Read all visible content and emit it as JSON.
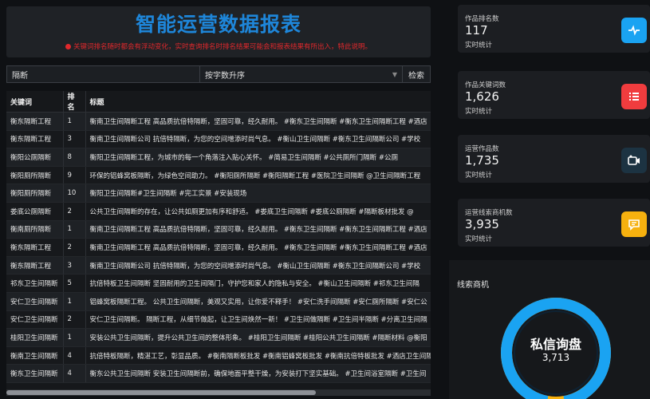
{
  "header": {
    "title": "智能运营数据报表",
    "notice": "关键词排名随时都会有浮动变化，实时查询排名时排名结果可能会和报表结果有所出入，特此说明。"
  },
  "search": {
    "keyword_value": "隔断",
    "sort_value": "按字数升序",
    "button_label": "检索"
  },
  "table": {
    "columns": [
      "关键词",
      "排名",
      "标题"
    ],
    "rows": [
      {
        "keyword": "衡东隔断工程",
        "rank": "1",
        "title": "衡南卫生间隔断工程 高品质抗倍特隔断，坚固可靠，经久耐用。 #衡东卫生间隔断 #衡东卫生间隔断工程 #酒店"
      },
      {
        "keyword": "衡东隔断工程",
        "rank": "3",
        "title": "衡南卫生间隔断公司 抗倍特隔断，为您的空间增添时尚气息。 #衡山卫生间隔断 #衡东卫生间隔断公司 #学校"
      },
      {
        "keyword": "衡阳公厕隔断",
        "rank": "8",
        "title": "衡阳卫生间隔断工程，为城市的每一个角落注入贴心关怀。 #简易卫生间隔断 #公共厕所门隔断 #公厕"
      },
      {
        "keyword": "衡阳厕所隔断",
        "rank": "9",
        "title": "环保的铝蜂窝板隔断，为绿色空间助力。 #衡阳厕所隔断 #衡阳隔断工程 #医院卫生间隔断 @卫生间隔断工程"
      },
      {
        "keyword": "衡阳厕所隔断",
        "rank": "10",
        "title": "衡阳卫生间隔断#卫生间隔断 #完工实景 #安装现场"
      },
      {
        "keyword": "娄底公厕隔断",
        "rank": "2",
        "title": "公共卫生间隔断的存在，让公共如厕更加有序和舒适。 #娄底卫生间隔断 #娄底公厕隔断 #隔断板材批发 @"
      },
      {
        "keyword": "衡南厕所隔断",
        "rank": "1",
        "title": "衡南卫生间隔断工程 高品质抗倍特隔断，坚固可靠，经久耐用。 #衡东卫生间隔断 #衡东卫生间隔断工程 #酒店"
      },
      {
        "keyword": "衡东隔断工程",
        "rank": "2",
        "title": "衡南卫生间隔断工程 高品质抗倍特隔断，坚固可靠，经久耐用。 #衡东卫生间隔断 #衡东卫生间隔断工程 #酒店"
      },
      {
        "keyword": "衡东隔断工程",
        "rank": "3",
        "title": "衡南卫生间隔断公司 抗倍特隔断，为您的空间增添时尚气息。 #衡山卫生间隔断 #衡东卫生间隔断公司 #学校"
      },
      {
        "keyword": "祁东卫生间隔断",
        "rank": "5",
        "title": "抗倍特板卫生间隔断 坚固耐用的卫生间隔门，守护您和家人的隐私与安全。 #衡山卫生间隔断 #祁东卫生间隔"
      },
      {
        "keyword": "安仁卫生间隔断",
        "rank": "1",
        "title": "铝蜂窝板隔断工程。 公共卫生间隔断，美观又实用，让你爱不释手！ #安仁洗手间隔断 #安仁厕所隔断 #安仁公"
      },
      {
        "keyword": "安仁卫生间隔断",
        "rank": "2",
        "title": "安仁卫生间隔断。 隔断工程，从细节做起，让卫生间焕然一新！ #卫生间做隔断 #卫生间半隔断 #分离卫生间隔"
      },
      {
        "keyword": "桂阳卫生间隔断",
        "rank": "1",
        "title": "安装公共卫生间隔断，提升公共卫生间的整体形象。 #桂阳卫生间隔断 #桂阳公共卫生间隔断 #隔断材料 @衡阳"
      },
      {
        "keyword": "衡南卫生间隔断",
        "rank": "4",
        "title": "抗倍特板隔断，精湛工艺，彰显品质。 #衡南隔断板批发 #衡南铝蜂窝板批发 #衡南抗倍特板批发 #酒店卫生间隔断"
      },
      {
        "keyword": "衡东卫生间隔断",
        "rank": "4",
        "title": "衡东公共卫生间隔断 安装卫生间隔断前，确保地面平整干燥，为安装打下坚实基础。 #卫生间浴室隔断 #卫生间"
      }
    ]
  },
  "stats": [
    {
      "label": "作品排名数",
      "value": "117",
      "sub": "实时统计",
      "icon": "activity-icon",
      "color": "#1aa3f2"
    },
    {
      "label": "作品关键词数",
      "value": "1,626",
      "sub": "实时统计",
      "icon": "list-icon",
      "color": "#f03c3e"
    },
    {
      "label": "运营作品数",
      "value": "1,735",
      "sub": "实时统计",
      "icon": "video-camera-icon",
      "color": "#1c3342"
    },
    {
      "label": "运营线索商机数",
      "value": "3,935",
      "sub": "实时统计",
      "icon": "chat-icon",
      "color": "#f6b10f"
    }
  ],
  "leads": {
    "title": "线索商机",
    "gauge_label": "私信询盘",
    "gauge_value": "3,713",
    "gauge_fraction": 0.944,
    "ring_color": "#1aa3f2",
    "rest_color": "#f6b10f"
  }
}
